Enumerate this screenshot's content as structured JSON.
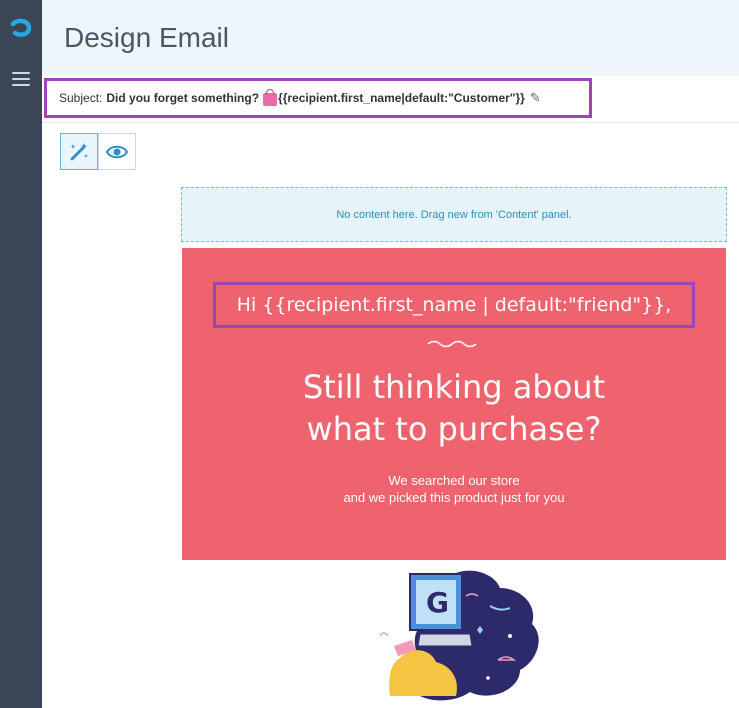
{
  "header": {
    "title": "Design Email"
  },
  "subject": {
    "label": "Subject:",
    "value": "Did you forget something?",
    "template": "{{recipient.first_name|default:\"Customer\"}}"
  },
  "toolbar": {
    "edit_icon": "magic-wand-icon",
    "preview_icon": "eye-icon"
  },
  "dropzone": {
    "text": "No content here. Drag new from 'Content' panel."
  },
  "hero": {
    "greeting": "Hi {{recipient.first_name | default:\"friend\"}},",
    "headline_line1": "Still thinking about",
    "headline_line2": "what to purchase?",
    "subtext_line1": "We searched our store",
    "subtext_line2": "and we picked this product just for you",
    "background": "#ee636e"
  },
  "colors": {
    "sidebar": "#3a4556",
    "highlight": "#9b45b6",
    "accent": "#2c8fc6"
  }
}
